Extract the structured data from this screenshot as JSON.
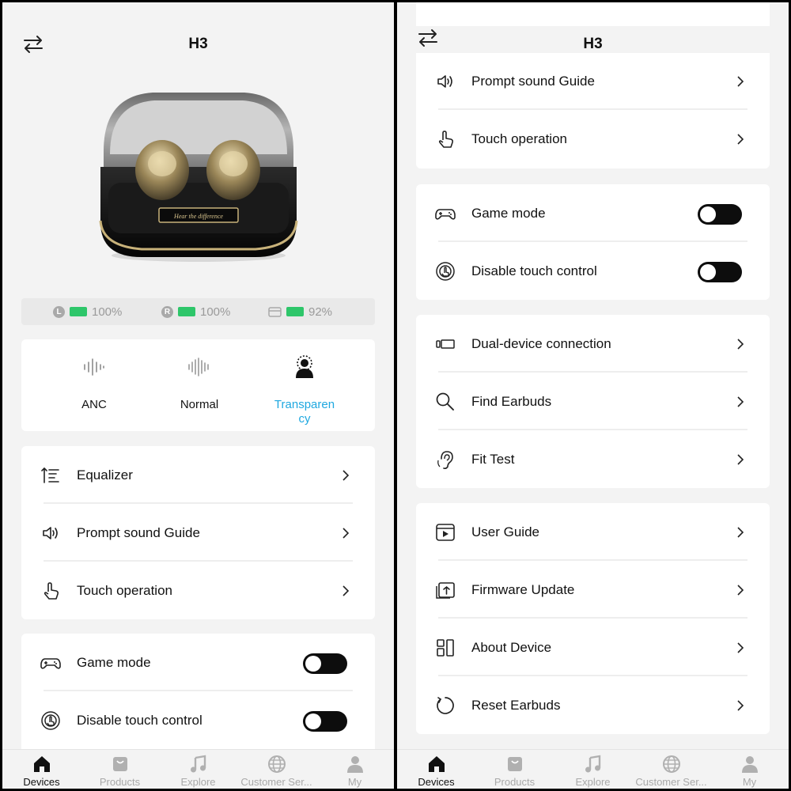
{
  "app": {
    "title": "H3"
  },
  "battery": {
    "left": {
      "badge": "L",
      "text": "100%"
    },
    "right": {
      "badge": "R",
      "text": "100%"
    },
    "case": {
      "text": "92%"
    }
  },
  "product_image": {
    "engraving": "Hear the difference"
  },
  "modes": [
    {
      "label": "ANC",
      "icon": "waveform-icon",
      "active": false
    },
    {
      "label": "Normal",
      "icon": "waveform-icon",
      "active": false
    },
    {
      "label": "Transparen\ncy",
      "icon": "person-aura-icon",
      "active": true
    }
  ],
  "settings": {
    "equalizer": "Equalizer",
    "prompt_sound": "Prompt sound Guide",
    "touch_operation": "Touch operation",
    "game_mode": "Game mode",
    "disable_touch": "Disable touch control",
    "dual_device": "Dual-device connection",
    "find_earbuds": "Find Earbuds",
    "fit_test": "Fit Test",
    "user_guide": "User Guide",
    "firmware_update": "Firmware Update",
    "about_device": "About Device",
    "reset_earbuds": "Reset Earbuds"
  },
  "toggles": {
    "game_mode": false,
    "disable_touch": false
  },
  "tabs": [
    {
      "label": "Devices",
      "icon": "home-icon",
      "active": true
    },
    {
      "label": "Products",
      "icon": "bag-icon",
      "active": false
    },
    {
      "label": "Explore",
      "icon": "music-note-icon",
      "active": false
    },
    {
      "label": "Customer Ser...",
      "icon": "globe-icon",
      "active": false
    },
    {
      "label": "My",
      "icon": "person-icon",
      "active": false
    }
  ],
  "colors": {
    "accent": "#1fa8e0",
    "battery": "#2ec66a",
    "toggle_off": "#0d0d0d"
  }
}
